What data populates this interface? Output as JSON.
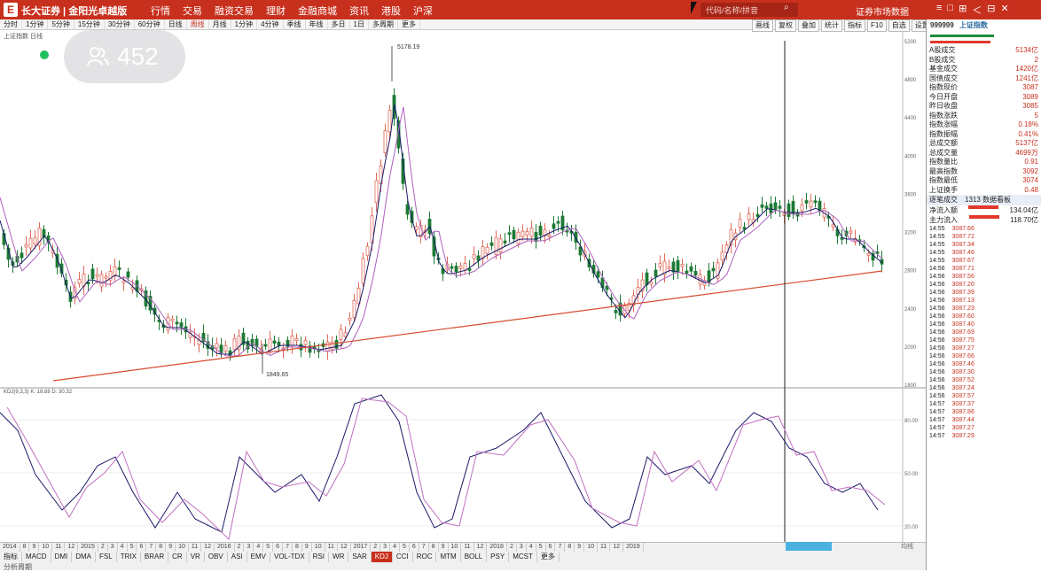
{
  "app": {
    "logo": "E",
    "brand": "长大证券 | 金阳光卓越版"
  },
  "menu": [
    "行情",
    "交易",
    "融资交易",
    "理财",
    "金融商城",
    "资讯",
    "港股",
    "沪深"
  ],
  "search": {
    "placeholder": "代码/名称/拼音"
  },
  "crumb": "证券市场数据",
  "window_buttons": [
    "≡",
    "□",
    "⊞",
    "＜",
    "⊟",
    "✕"
  ],
  "toolbar": {
    "items": [
      "分时",
      "1分钟",
      "5分钟",
      "15分钟",
      "30分钟",
      "60分钟",
      "日线",
      "周线",
      "月线",
      "1分钟",
      "4分钟",
      "季线",
      "年线",
      "多日",
      "1日",
      "多周期",
      "更多"
    ],
    "active": 7
  },
  "toolbar_right": [
    "画线",
    "复权",
    "叠加",
    "统计",
    "指标",
    "F10",
    "自选",
    "设置"
  ],
  "info_line": "上证指数 日线",
  "chart_data": {
    "type": "candlestick",
    "price_labels": [
      "5200",
      "4800",
      "4400",
      "4000",
      "3600",
      "3200",
      "2800",
      "2400",
      "2000",
      "1800"
    ],
    "peak_label": "5178.19",
    "low_label": "1849.65",
    "kdj_label": "KDJ(9,3,3) K: 18.88 D: 30.32",
    "kdj_levels": [
      "80.00",
      "50.00",
      "20.00"
    ]
  },
  "overlay": {
    "viewer_count": "452"
  },
  "side": {
    "code": "999999",
    "name": "上证指数",
    "rows": [
      {
        "label": "A股成交",
        "value": "5134亿"
      },
      {
        "label": "B股成交",
        "value": "2"
      },
      {
        "label": "基金成交",
        "value": "1420亿"
      },
      {
        "label": "国债成交",
        "value": "1241亿"
      },
      {
        "label": "指数现价",
        "value": "3087"
      },
      {
        "label": "今日开盘",
        "value": "3089"
      },
      {
        "label": "昨日收盘",
        "value": "3085"
      },
      {
        "label": "指数涨跌",
        "value": "5"
      },
      {
        "label": "指数涨幅",
        "value": "0.18%"
      },
      {
        "label": "指数振幅",
        "value": "0.41%"
      },
      {
        "label": "总成交额",
        "value": "5137亿"
      },
      {
        "label": "总成交量",
        "value": "4699万"
      },
      {
        "label": "指数量比",
        "value": "0.91"
      },
      {
        "label": "最高指数",
        "value": "3092"
      },
      {
        "label": "指数最低",
        "value": "3074"
      },
      {
        "label": "上证换手",
        "value": "0.48"
      }
    ],
    "sub_tabs": [
      "逐笔成交",
      "1313 数据看板"
    ],
    "flows": [
      {
        "label": "净流入额",
        "value": "134.04亿"
      },
      {
        "label": "主力流入",
        "value": "118.70亿"
      }
    ],
    "ticks": [
      {
        "time": "14:55",
        "price": "3087.66"
      },
      {
        "time": "14:55",
        "price": "3087.72"
      },
      {
        "time": "14:55",
        "price": "3087.34"
      },
      {
        "time": "14:55",
        "price": "3087.46"
      },
      {
        "time": "14:55",
        "price": "3087.67"
      },
      {
        "time": "14:56",
        "price": "3087.71"
      },
      {
        "time": "14:56",
        "price": "3087.56"
      },
      {
        "time": "14:56",
        "price": "3087.20"
      },
      {
        "time": "14:56",
        "price": "3087.39"
      },
      {
        "time": "14:56",
        "price": "3087.13"
      },
      {
        "time": "14:56",
        "price": "3087.23"
      },
      {
        "time": "14:56",
        "price": "3087.60"
      },
      {
        "time": "14:56",
        "price": "3087.40"
      },
      {
        "time": "14:56",
        "price": "3087.69"
      },
      {
        "time": "14:56",
        "price": "3087.75"
      },
      {
        "time": "14:56",
        "price": "3087.27"
      },
      {
        "time": "14:56",
        "price": "3087.66"
      },
      {
        "time": "14:56",
        "price": "3087.46"
      },
      {
        "time": "14:56",
        "price": "3087.30"
      },
      {
        "time": "14:56",
        "price": "3087.52"
      },
      {
        "time": "14:56",
        "price": "3087.24"
      },
      {
        "time": "14:56",
        "price": "3087.57"
      },
      {
        "time": "14:57",
        "price": "3087.37"
      },
      {
        "time": "14:57",
        "price": "3087.86"
      },
      {
        "time": "14:57",
        "price": "3087.44"
      },
      {
        "time": "14:57",
        "price": "3087.27"
      },
      {
        "time": "14:57",
        "price": "3087.29"
      }
    ]
  },
  "bottom": {
    "dates": [
      "2014",
      "8",
      "9",
      "10",
      "11",
      "12",
      "2015",
      "2",
      "3",
      "4",
      "5",
      "6",
      "7",
      "8",
      "9",
      "10",
      "11",
      "12",
      "2016",
      "2",
      "3",
      "4",
      "5",
      "6",
      "7",
      "8",
      "9",
      "10",
      "11",
      "12",
      "2017",
      "2",
      "3",
      "4",
      "5",
      "6",
      "7",
      "8",
      "9",
      "10",
      "11",
      "12",
      "2018",
      "2",
      "3",
      "4",
      "5",
      "6",
      "7",
      "8",
      "9",
      "10",
      "11",
      "12",
      "2019"
    ],
    "tabs": [
      "指标",
      "MACD",
      "DMI",
      "DMA",
      "FSL",
      "TRIX",
      "BRAR",
      "CR",
      "VR",
      "OBV",
      "ASI",
      "EMV",
      "VOL-TDX",
      "RSI",
      "WR",
      "SAR",
      "KDJ",
      "CCI",
      "ROC",
      "MTM",
      "BOLL",
      "PSY",
      "MCST",
      "更多"
    ],
    "active_tab": 16,
    "status": "分析周期",
    "scale": "均线"
  }
}
